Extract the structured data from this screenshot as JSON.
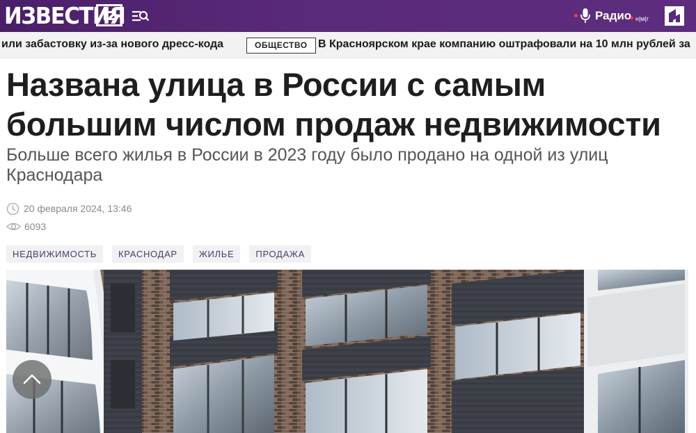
{
  "header": {
    "logo_text": "ИЗВЕСТИЯ",
    "logo_badge": "iz",
    "radio_label": "Радио",
    "radio_freq": "н|м|г",
    "icons": {
      "menu": "menu-search-icon",
      "mic": "microphone-icon",
      "channel": "channel5-logo-icon"
    }
  },
  "ticker": {
    "left_text": "или забастовку из-за нового дресс-кода",
    "badge": "ОБЩЕСТВО",
    "right_text": "В Красноярском крае компанию оштрафовали на 10 млн рублей за"
  },
  "article": {
    "title": "Названа улица в России с самым большим числом продаж недвижимости",
    "subtitle": "Больше всего жилья в России в 2023 году было продано на одной из улиц Краснодара",
    "date": "20 февраля 2024, 13:46",
    "views": "6093",
    "tags": [
      "НЕДВИЖИМОСТЬ",
      "КРАСНОДАР",
      "ЖИЛЬЕ",
      "ПРОДАЖА"
    ]
  },
  "colors": {
    "header_bg": "#5a2a7a",
    "tag_text": "#4d3a63",
    "ticker_bg": "#f2f2f2"
  }
}
